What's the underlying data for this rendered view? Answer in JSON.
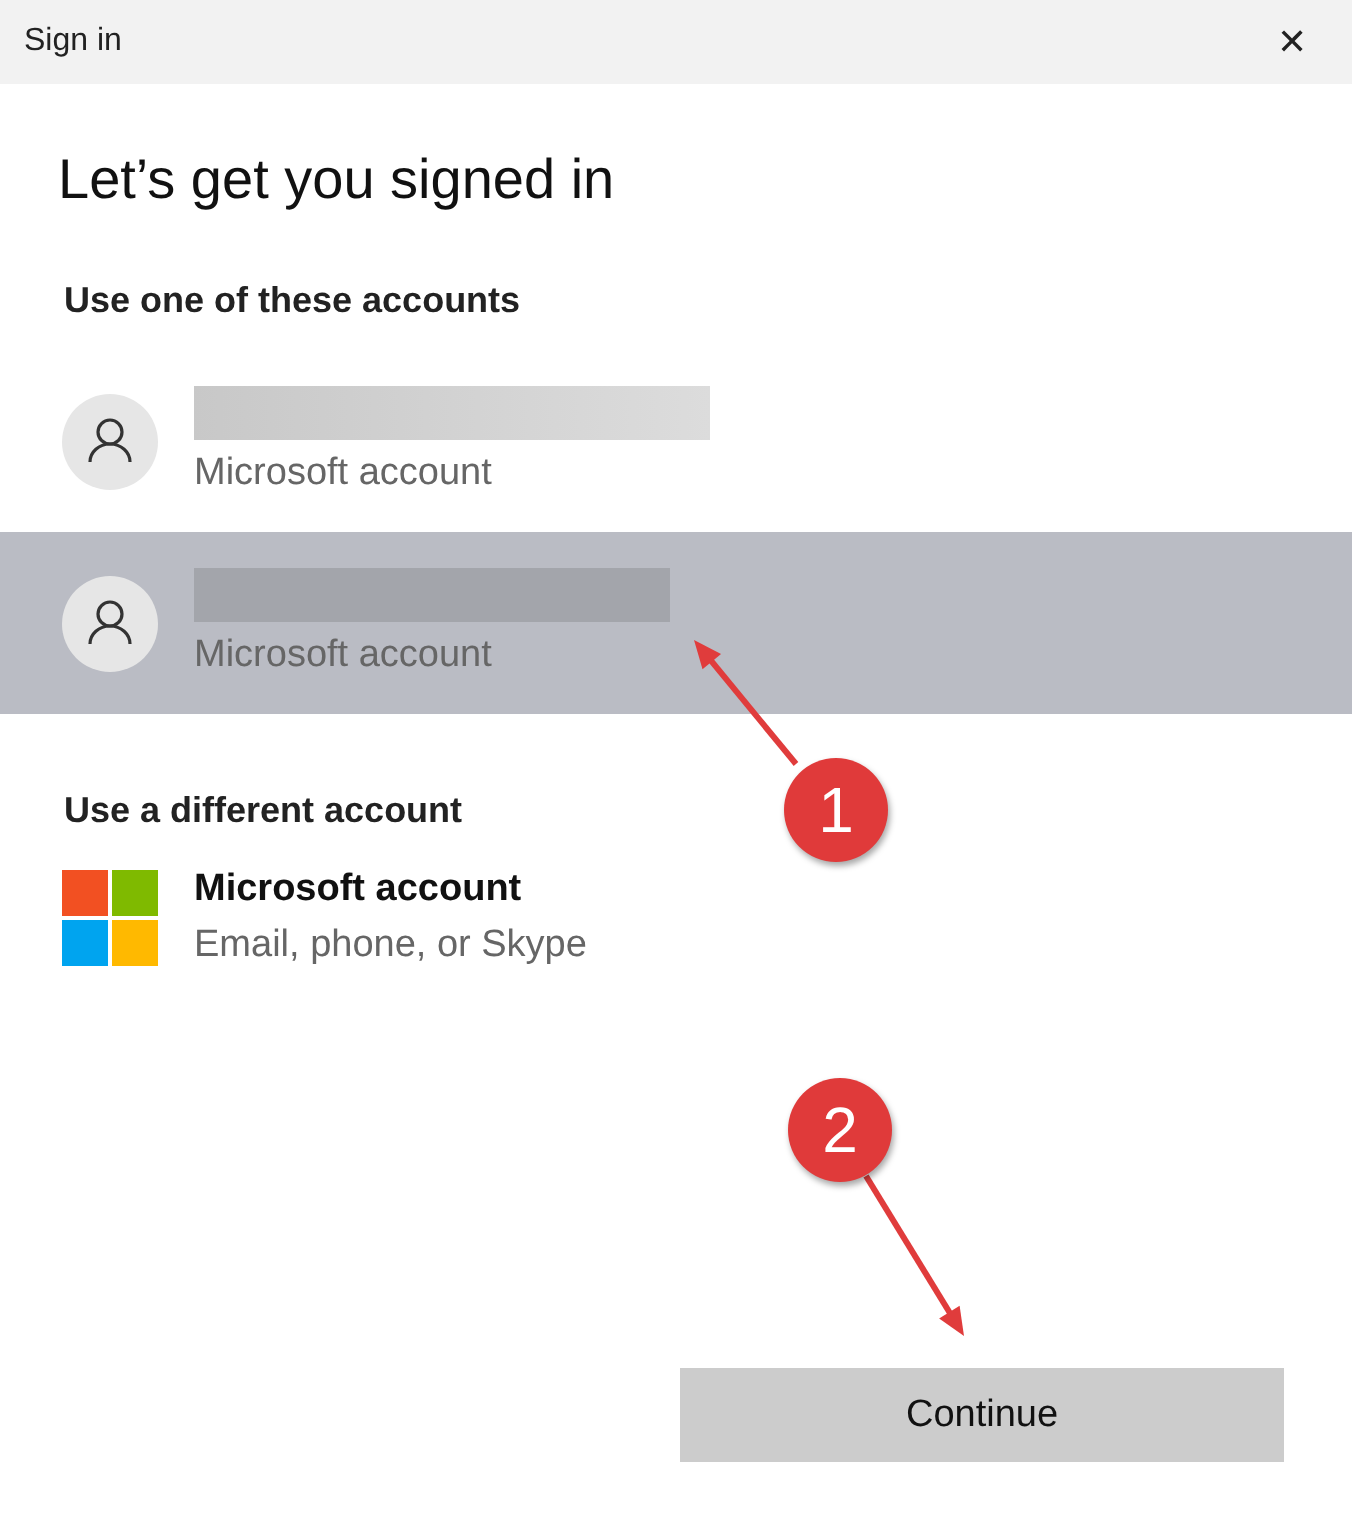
{
  "window": {
    "title": "Sign in",
    "close": "✕"
  },
  "heading": "Let’s get you signed in",
  "accounts_section": {
    "title": "Use one of these accounts",
    "accounts": [
      {
        "subtitle": "Microsoft account",
        "selected": false
      },
      {
        "subtitle": "Microsoft account",
        "selected": true
      }
    ]
  },
  "other_section": {
    "title": "Use a different account",
    "option": {
      "title": "Microsoft account",
      "subtitle": "Email, phone, or Skype"
    }
  },
  "continue_button": "Continue",
  "annotations": [
    {
      "label": "1"
    },
    {
      "label": "2"
    }
  ]
}
